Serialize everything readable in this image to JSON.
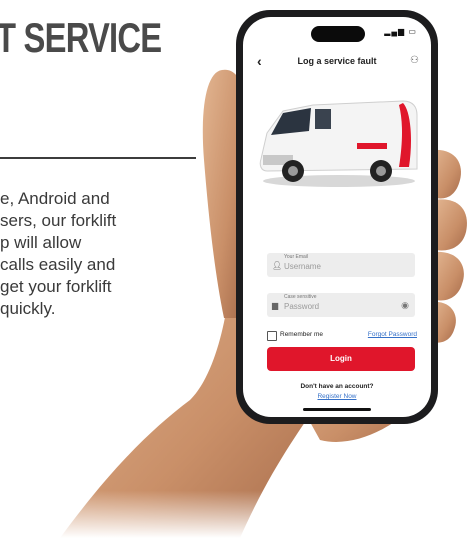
{
  "page": {
    "headline": "T SERVICE",
    "body_lines": [
      "e, Android and",
      "sers, our forklift",
      "p will allow",
      "calls easily and",
      "get your forklift",
      "quickly."
    ]
  },
  "app": {
    "nav": {
      "title": "Log a service fault"
    },
    "form": {
      "email": {
        "label": "Your Email",
        "placeholder": "Username"
      },
      "password": {
        "label": "Case sensitive",
        "placeholder": "Password"
      },
      "remember_label": "Remember me",
      "forgot_label": "Forgot Password",
      "login_label": "Login",
      "no_account_text": "Don't have an account?",
      "register_label": "Register Now"
    }
  },
  "colors": {
    "accent": "#e0162b",
    "link": "#3470c8",
    "headline": "#4a4a4a"
  }
}
